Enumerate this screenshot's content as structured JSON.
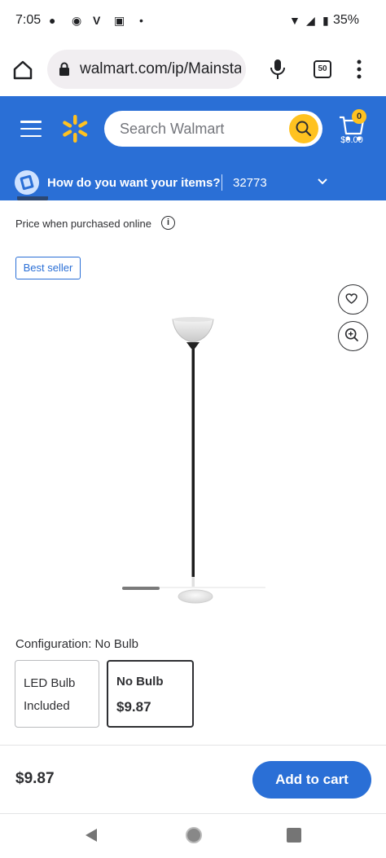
{
  "status_bar": {
    "time": "7:05",
    "battery_text": "35%"
  },
  "browser": {
    "url": "walmart.com/ip/Mainsta",
    "tab_count": "50"
  },
  "header": {
    "search_placeholder": "Search Walmart",
    "cart_count": "0",
    "cart_total": "$0.00",
    "brand_color": "#2a6fd6",
    "accent_color": "#ffc220"
  },
  "delivery": {
    "question": "How do you want your items?",
    "zip": "32773"
  },
  "product": {
    "price_note": "Price when purchased online",
    "info_symbol": "i",
    "badge": "Best seller",
    "configuration_label": "Configuration: No Bulb",
    "options": [
      {
        "name": "LED Bulb Included",
        "price": "",
        "selected": false
      },
      {
        "name": "No Bulb",
        "price": "$9.87",
        "selected": true
      }
    ]
  },
  "footer": {
    "price": "$9.87",
    "add_to_cart": "Add to cart"
  },
  "icons": {
    "home": "home-icon",
    "lock": "lock-icon",
    "mic": "mic-icon",
    "tabs": "tabs-icon",
    "menu": "kebab-menu-icon",
    "hamburger": "hamburger-icon",
    "spark": "walmart-spark-icon",
    "search": "search-icon",
    "cart": "cart-icon",
    "favorite": "heart-icon",
    "zoom": "zoom-in-icon",
    "info": "info-icon",
    "chevron": "chevron-down-icon"
  }
}
